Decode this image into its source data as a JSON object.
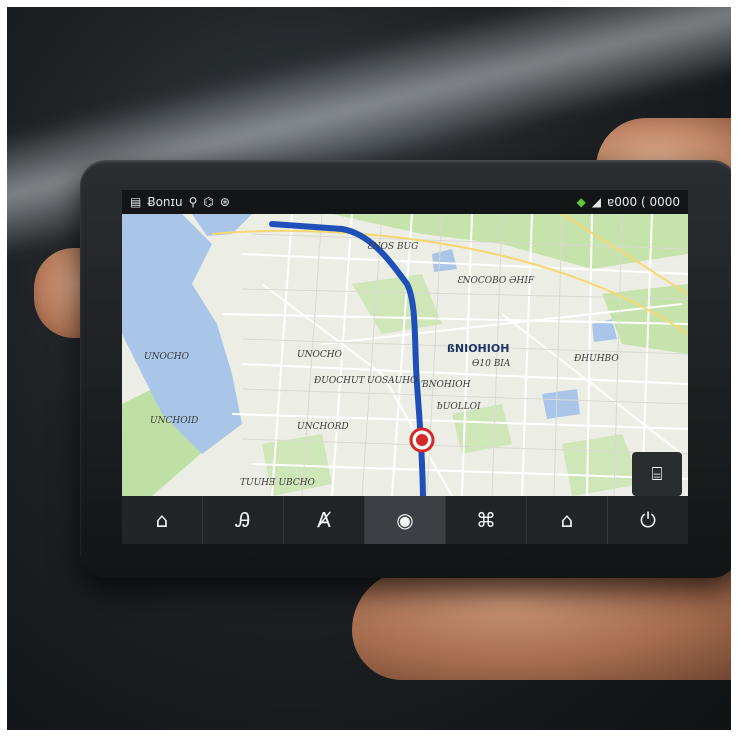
{
  "status_bar": {
    "left_text": "Ƀonɪu",
    "left_icons": [
      "battery-icon",
      "pin-icon",
      "signal-icon",
      "gps-icon"
    ],
    "right_text": "ɐ000 ( 0000",
    "right_icons": [
      "shield-icon",
      "signal-strength-icon"
    ]
  },
  "map": {
    "labels": {
      "l1": "ƐNOS BUG",
      "l2": "ƐNOCOBO\nƏHIF",
      "l3": "ßNIOHIOH",
      "l4": "Ɵ10 BIA",
      "l5": "UNOCHO",
      "l6": "UNOCHO",
      "l7": "ƉUOCHUT",
      "l8": "UOSAUHO",
      "l9": "UNCHOID",
      "l10": "UNCHORD",
      "l11": "ƀUOLLOI",
      "l12": "TUUHƎ UBCHO",
      "l13": "ƉHUHBO",
      "l14": "ƁNOHIOH"
    },
    "route_color": "#1f4fb8",
    "water_color": "#a9c6e8",
    "park_color": "#bfe0a4"
  },
  "map_button_icon": "layers-icon",
  "bottom_nav": [
    {
      "icon": "home-icon",
      "glyph": "⌂"
    },
    {
      "icon": "fuel-icon",
      "glyph": "Ꭿ"
    },
    {
      "icon": "parking-icon",
      "glyph": "Ⱥ"
    },
    {
      "icon": "navigate-icon",
      "glyph": "◉"
    },
    {
      "icon": "media-icon",
      "glyph": "⌘"
    },
    {
      "icon": "garage-icon",
      "glyph": "⌂"
    },
    {
      "icon": "power-icon",
      "glyph": "⏻"
    }
  ]
}
